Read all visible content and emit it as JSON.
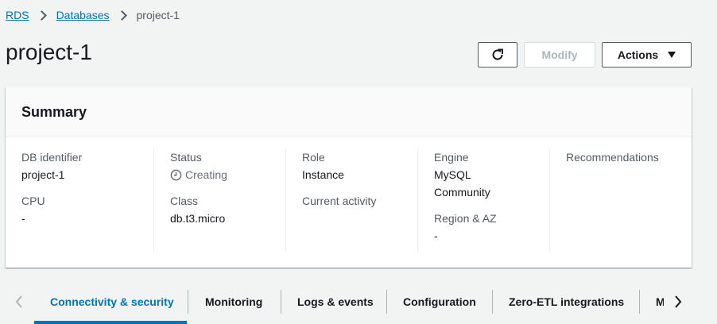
{
  "breadcrumb": {
    "items": [
      {
        "label": "RDS"
      },
      {
        "label": "Databases"
      }
    ],
    "current": "project-1"
  },
  "page": {
    "title": "project-1"
  },
  "toolbar": {
    "refresh_icon": "refresh-icon",
    "modify_label": "Modify",
    "actions_label": "Actions"
  },
  "summary": {
    "title": "Summary",
    "db_identifier_label": "DB identifier",
    "db_identifier_value": "project-1",
    "cpu_label": "CPU",
    "cpu_value": "-",
    "status_label": "Status",
    "status_value": "Creating",
    "status_icon": "clock-icon",
    "class_label": "Class",
    "class_value": "db.t3.micro",
    "role_label": "Role",
    "role_value": "Instance",
    "current_activity_label": "Current activity",
    "engine_label": "Engine",
    "engine_value": "MySQL Community",
    "region_label": "Region & AZ",
    "region_value": "-",
    "recommendations_label": "Recommendations"
  },
  "tabs": {
    "items": [
      {
        "label": "Connectivity & security",
        "active": true
      },
      {
        "label": "Monitoring"
      },
      {
        "label": "Logs & events"
      },
      {
        "label": "Configuration"
      },
      {
        "label": "Zero-ETL integrations"
      },
      {
        "label": "M"
      }
    ]
  },
  "colors": {
    "link": "#0073bb",
    "background": "#f2f3f3",
    "text": "#16191f",
    "muted": "#545b64"
  }
}
